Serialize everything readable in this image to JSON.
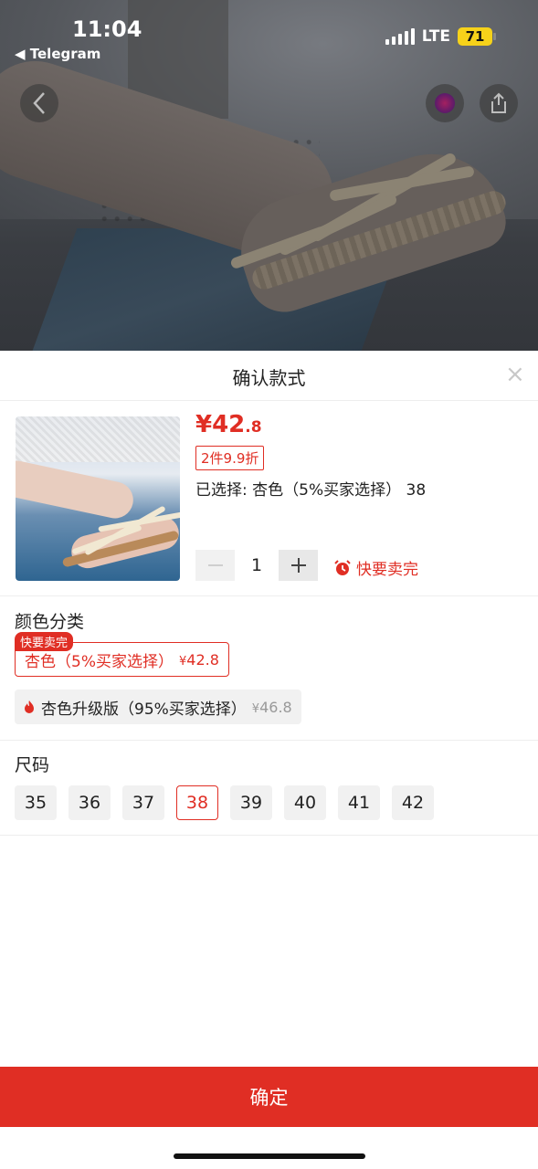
{
  "status_bar": {
    "time": "11:04",
    "back_app": "◀ Telegram",
    "network": "LTE",
    "battery": "71"
  },
  "sheet": {
    "title": "确认款式",
    "close_icon": "close-icon"
  },
  "product": {
    "price_main": "¥42",
    "price_decimal": ".8",
    "promo": "2件9.9折",
    "selected_text": "已选择: 杏色（5%买家选择） 38",
    "quantity": "1",
    "selling_fast": "快要卖完"
  },
  "color_section": {
    "label": "颜色分类",
    "badge": "快要卖完",
    "options": [
      {
        "name": "杏色（5%买家选择）",
        "yen": "¥",
        "price": "42.8",
        "selected": true
      },
      {
        "name": "杏色升级版（95%买家选择）",
        "yen": "¥",
        "price": "46.8",
        "selected": false
      }
    ]
  },
  "size_section": {
    "label": "尺码",
    "sizes": [
      "35",
      "36",
      "37",
      "38",
      "39",
      "40",
      "41",
      "42"
    ],
    "selected": "38"
  },
  "confirm_label": "确定",
  "colors": {
    "accent": "#e02e24",
    "battery": "#f6d21a"
  }
}
